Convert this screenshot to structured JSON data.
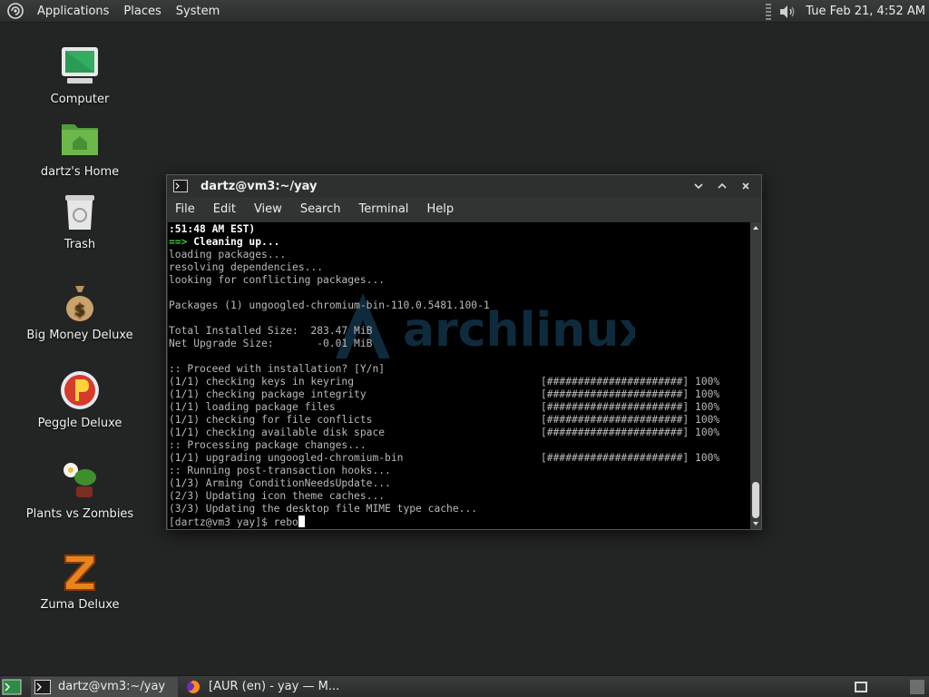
{
  "top_panel": {
    "menus": [
      "Applications",
      "Places",
      "System"
    ],
    "clock": "Tue Feb 21,  4:52 AM"
  },
  "desktop_icons": [
    {
      "label": "Computer",
      "icon": "computer-icon"
    },
    {
      "label": "dartz's Home",
      "icon": "home-folder-icon"
    },
    {
      "label": "Trash",
      "icon": "trash-icon"
    },
    {
      "label": "Big Money Deluxe",
      "icon": "money-bag-icon"
    },
    {
      "label": "Peggle Deluxe",
      "icon": "peggle-icon"
    },
    {
      "label": "Plants vs Zombies",
      "icon": "plants-vs-zombies-icon"
    },
    {
      "label": "Zuma Deluxe",
      "icon": "zuma-icon"
    }
  ],
  "terminal": {
    "title": "dartz@vm3:~/yay",
    "menu": [
      "File",
      "Edit",
      "View",
      "Search",
      "Terminal",
      "Help"
    ],
    "lines": [
      ":51:48 AM EST)",
      "Cleaning up...",
      "loading packages...",
      "resolving dependencies...",
      "looking for conflicting packages...",
      "",
      "Packages (1) ungoogled-chromium-bin-110.0.5481.100-1",
      "",
      "Total Installed Size:  283.47 MiB",
      "Net Upgrade Size:       -0.01 MiB",
      "",
      ":: Proceed with installation? [Y/n]",
      "(1/1) checking keys in keyring",
      "(1/1) checking package integrity",
      "(1/1) loading package files",
      "(1/1) checking for file conflicts",
      "(1/1) checking available disk space",
      ":: Processing package changes...",
      "(1/1) upgrading ungoogled-chromium-bin",
      ":: Running post-transaction hooks...",
      "(1/3) Arming ConditionNeedsUpdate...",
      "(2/3) Updating icon theme caches...",
      "(3/3) Updating the desktop file MIME type cache...",
      "[dartz@vm3 yay]$ rebo"
    ],
    "arrow": "==>",
    "progress_bar": "[######################] 100%",
    "watermark": "archlinux"
  },
  "taskbar": {
    "tasks": [
      {
        "label": "dartz@vm3:~/yay",
        "icon": "terminal-icon"
      },
      {
        "label": "[AUR (en) - yay — M...",
        "icon": "firefox-icon"
      }
    ]
  },
  "colors": {
    "desktop_bg": "#232524",
    "panel_bg": "#2f3130",
    "terminal_bg": "#000000",
    "terminal_text": "#b9b9b9",
    "arrow_green": "#3fc43f"
  }
}
